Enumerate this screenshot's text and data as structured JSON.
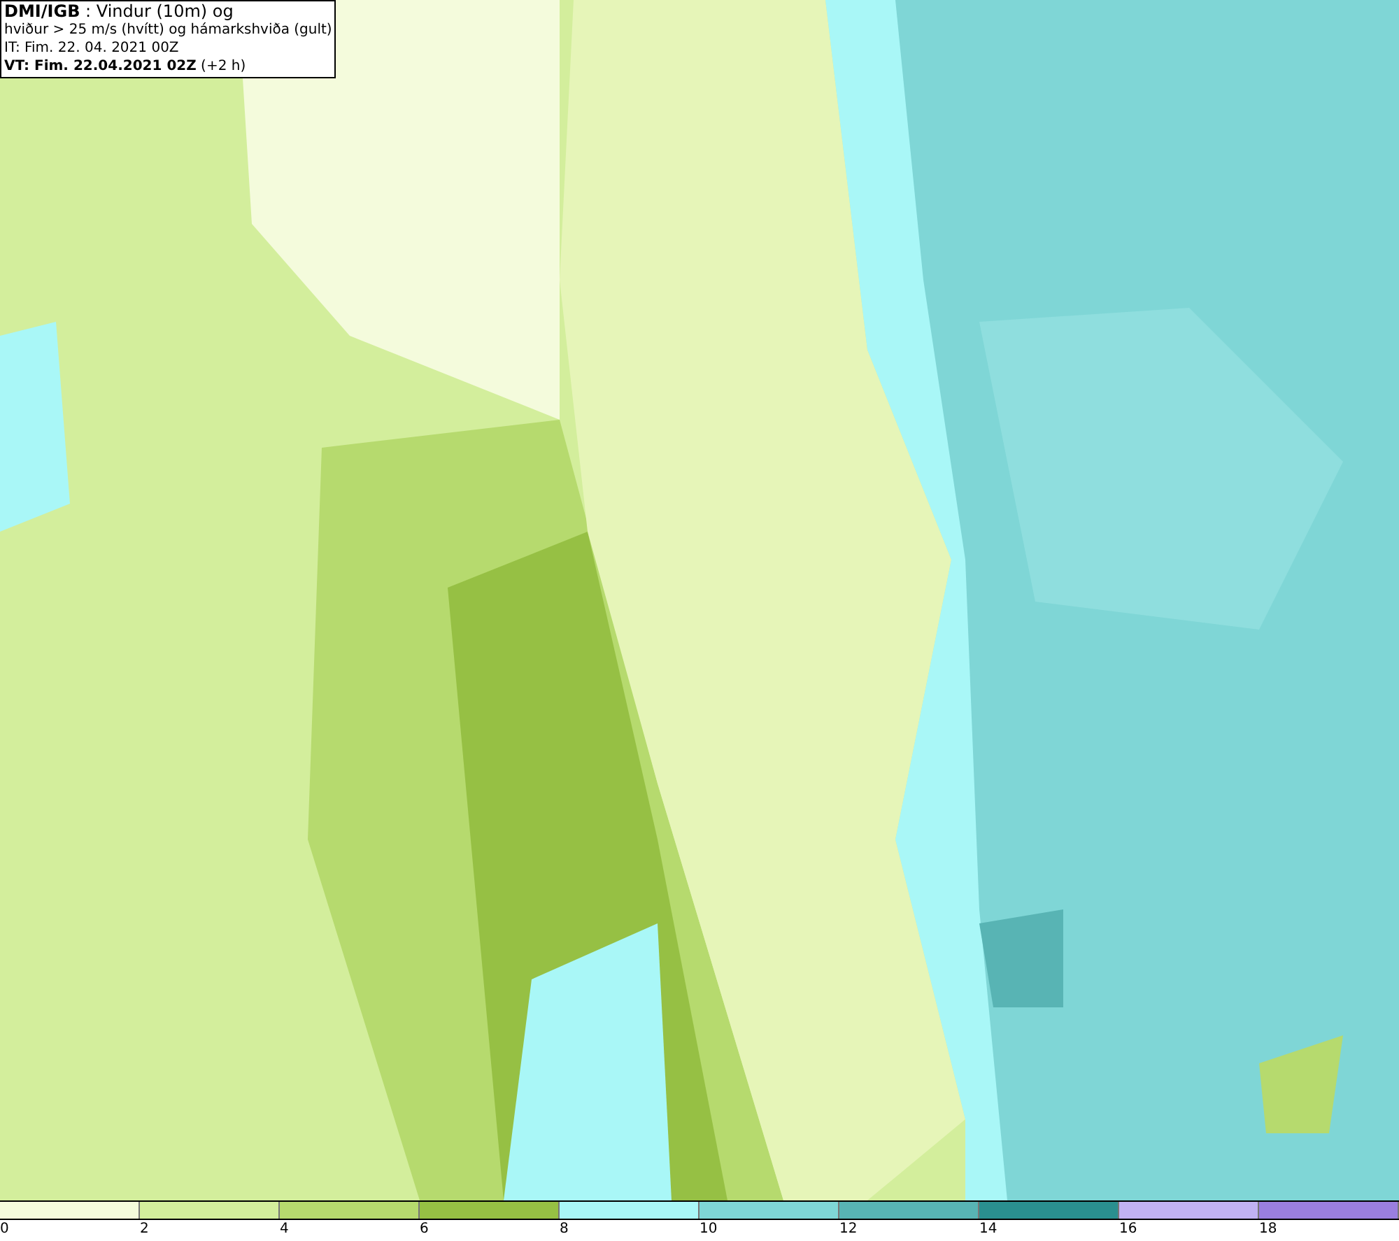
{
  "info_box": {
    "lines": [
      "**DMI/IGB** : Vindur (10m) og",
      "hviður > 25 m/s (hvítt) og hámarkshviða (gult)",
      "IT: Fim. 22. 04. 2021 00Z",
      "**VT: Fim. 22.04.2021 02Z** (+2 h)"
    ]
  },
  "legend": {
    "segments": [
      {
        "color": "#f4fbdc"
      },
      {
        "color": "#d3ee9c"
      },
      {
        "color": "#b6da6e"
      },
      {
        "color": "#96c044"
      },
      {
        "color": "#a9f7f7"
      },
      {
        "color": "#7fd6d6"
      },
      {
        "color": "#58b4b4"
      },
      {
        "color": "#2a8f8f"
      },
      {
        "color": "#c1b2f3"
      },
      {
        "color": "#9a7fdf"
      }
    ],
    "labels": [
      "0",
      "2",
      "4",
      "6",
      "8",
      "10",
      "12",
      "14",
      "16",
      "18"
    ]
  }
}
